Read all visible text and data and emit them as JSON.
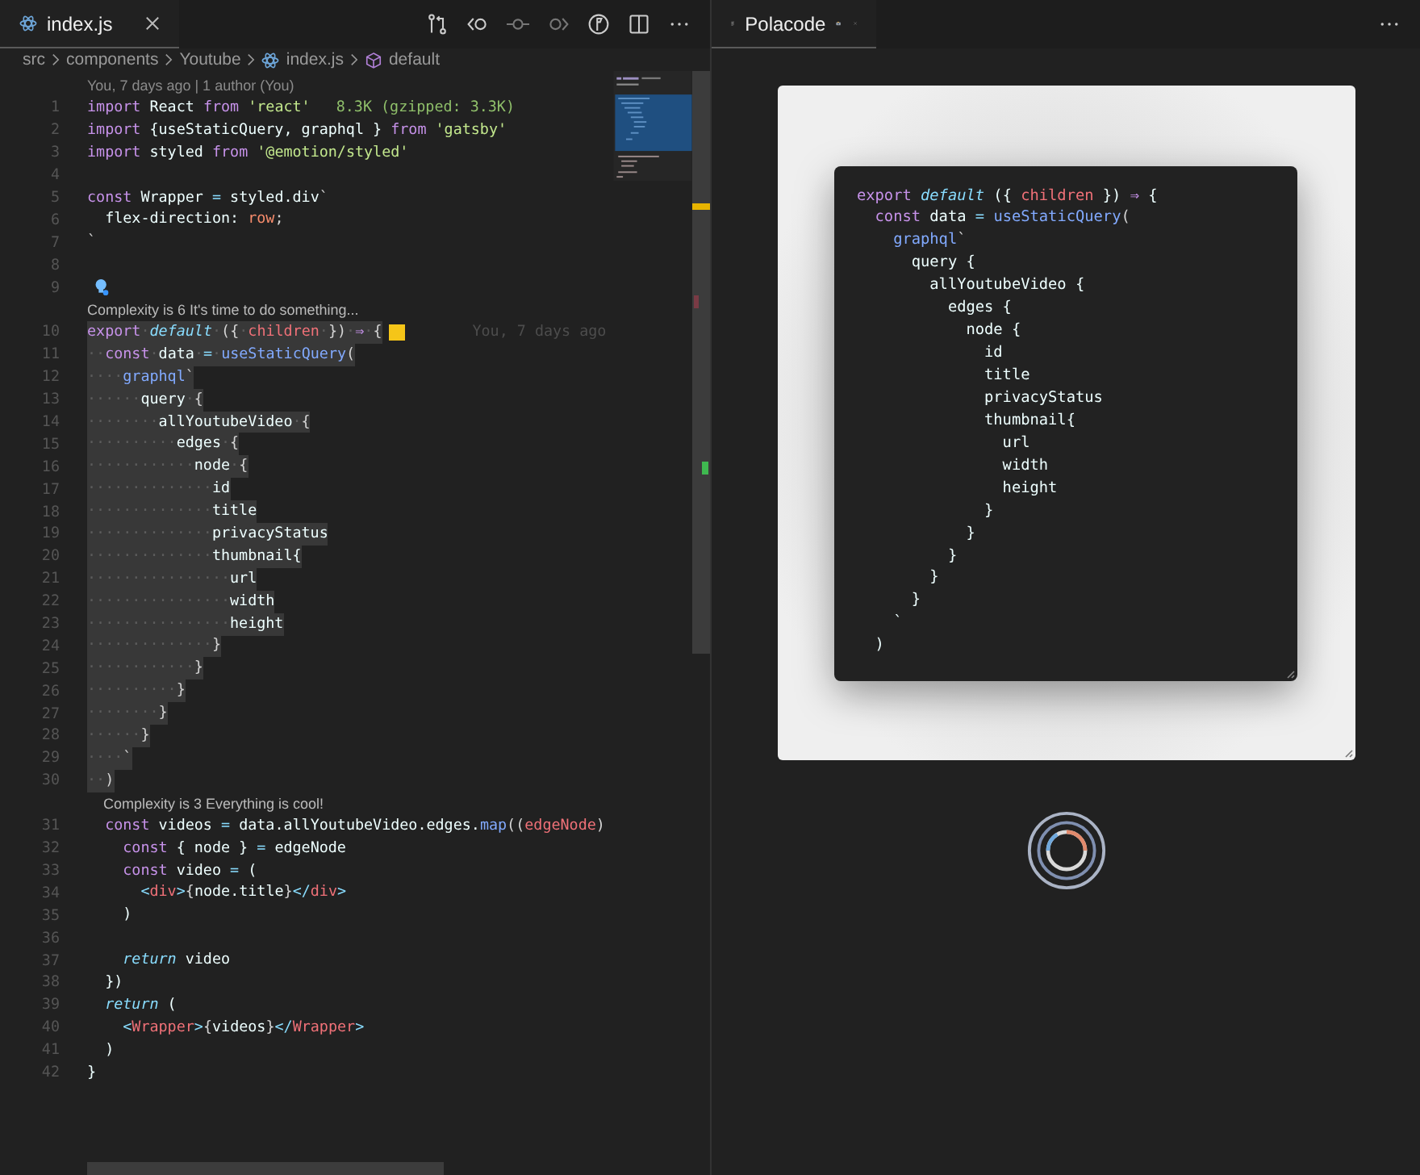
{
  "editor": {
    "tab": {
      "label": "index.js",
      "selected": true
    },
    "breadcrumbs": [
      "src",
      "components",
      "Youtube",
      "index.js",
      "default"
    ],
    "blame_header": "You, 7 days ago | 1 author (You)",
    "lines": [
      {
        "kind": "code",
        "number": "1",
        "selected": false,
        "annotation": "8.3K (gzipped: 3.3K)",
        "tokens": [
          {
            "kind": "keyword",
            "text": "import"
          },
          {
            "kind": "plain",
            "text": " React "
          },
          {
            "kind": "keyword",
            "text": "from"
          },
          {
            "kind": "string",
            "text": " 'react'"
          }
        ]
      },
      {
        "kind": "code",
        "number": "2",
        "selected": false,
        "tokens": [
          {
            "kind": "keyword",
            "text": "import"
          },
          {
            "kind": "plain",
            "text": " {useStaticQuery, graphql } "
          },
          {
            "kind": "keyword",
            "text": "from"
          },
          {
            "kind": "string",
            "text": " 'gatsby'"
          }
        ]
      },
      {
        "kind": "code",
        "number": "3",
        "selected": false,
        "tokens": [
          {
            "kind": "keyword",
            "text": "import"
          },
          {
            "kind": "plain",
            "text": " styled "
          },
          {
            "kind": "keyword",
            "text": "from"
          },
          {
            "kind": "string",
            "text": " '@emotion/styled'"
          }
        ]
      },
      {
        "kind": "code",
        "number": "4",
        "selected": false
      },
      {
        "kind": "code",
        "number": "5",
        "selected": false,
        "tokens": [
          {
            "kind": "keyword",
            "text": "const"
          },
          {
            "kind": "plain",
            "text": " Wrapper "
          },
          {
            "kind": "op",
            "text": "="
          },
          {
            "kind": "plain",
            "text": " styled.div"
          },
          {
            "kind": "punct",
            "text": "`"
          }
        ]
      },
      {
        "kind": "code",
        "number": "6",
        "selected": false,
        "tokens": [
          {
            "kind": "plain",
            "text": "  flex-direction: "
          },
          {
            "kind": "number",
            "text": "row"
          },
          {
            "kind": "punct",
            "text": ";"
          }
        ]
      },
      {
        "kind": "code",
        "number": "7",
        "selected": false,
        "tokens": [
          {
            "kind": "punct",
            "text": "`"
          }
        ]
      },
      {
        "kind": "code",
        "number": "8",
        "selected": false
      },
      {
        "kind": "code",
        "number": "9",
        "selected": false,
        "lightbulb": true
      },
      {
        "kind": "lens",
        "text": "Complexity is 6 It's time to do something..."
      },
      {
        "kind": "code",
        "number": "10",
        "selected": true,
        "blame": "You, 7 days ago",
        "tokens": [
          {
            "kind": "keyword",
            "text": "export"
          },
          {
            "kind": "ws",
            "text": "·"
          },
          {
            "kind": "italic",
            "text": "default"
          },
          {
            "kind": "ws",
            "text": "·"
          },
          {
            "kind": "punct",
            "text": "({"
          },
          {
            "kind": "ws",
            "text": "·"
          },
          {
            "kind": "param",
            "text": "children"
          },
          {
            "kind": "ws",
            "text": "·"
          },
          {
            "kind": "punct",
            "text": "})"
          },
          {
            "kind": "ws",
            "text": "·"
          },
          {
            "kind": "keyword",
            "text": "⇒"
          },
          {
            "kind": "ws",
            "text": "·"
          },
          {
            "kind": "punct",
            "text": "{"
          }
        ]
      },
      {
        "kind": "code",
        "number": "11",
        "selected": true,
        "tokens": [
          {
            "kind": "ws",
            "text": "··"
          },
          {
            "kind": "keyword",
            "text": "const"
          },
          {
            "kind": "ws",
            "text": "·"
          },
          {
            "kind": "plain",
            "text": "data"
          },
          {
            "kind": "ws",
            "text": "·"
          },
          {
            "kind": "op",
            "text": "="
          },
          {
            "kind": "ws",
            "text": "·"
          },
          {
            "kind": "fn",
            "text": "useStaticQuery"
          },
          {
            "kind": "punct",
            "text": "("
          }
        ]
      },
      {
        "kind": "code",
        "number": "12",
        "selected": true,
        "tokens": [
          {
            "kind": "ws",
            "text": "····"
          },
          {
            "kind": "fn",
            "text": "graphql"
          },
          {
            "kind": "punct",
            "text": "`"
          }
        ]
      },
      {
        "kind": "code",
        "number": "13",
        "selected": true,
        "tokens": [
          {
            "kind": "ws",
            "text": "······"
          },
          {
            "kind": "plain",
            "text": "query"
          },
          {
            "kind": "ws",
            "text": "·"
          },
          {
            "kind": "punct",
            "text": "{"
          }
        ]
      },
      {
        "kind": "code",
        "number": "14",
        "selected": true,
        "tokens": [
          {
            "kind": "ws",
            "text": "········"
          },
          {
            "kind": "plain",
            "text": "allYoutubeVideo"
          },
          {
            "kind": "ws",
            "text": "·"
          },
          {
            "kind": "punct",
            "text": "{"
          }
        ]
      },
      {
        "kind": "code",
        "number": "15",
        "selected": true,
        "tokens": [
          {
            "kind": "ws",
            "text": "··········"
          },
          {
            "kind": "plain",
            "text": "edges"
          },
          {
            "kind": "ws",
            "text": "·"
          },
          {
            "kind": "punct",
            "text": "{"
          }
        ]
      },
      {
        "kind": "code",
        "number": "16",
        "selected": true,
        "tokens": [
          {
            "kind": "ws",
            "text": "············"
          },
          {
            "kind": "plain",
            "text": "node"
          },
          {
            "kind": "ws",
            "text": "·"
          },
          {
            "kind": "punct",
            "text": "{"
          }
        ]
      },
      {
        "kind": "code",
        "number": "17",
        "selected": true,
        "tokens": [
          {
            "kind": "ws",
            "text": "··············"
          },
          {
            "kind": "plain",
            "text": "id"
          }
        ]
      },
      {
        "kind": "code",
        "number": "18",
        "selected": true,
        "tokens": [
          {
            "kind": "ws",
            "text": "··············"
          },
          {
            "kind": "plain",
            "text": "title"
          }
        ]
      },
      {
        "kind": "code",
        "number": "19",
        "selected": true,
        "tokens": [
          {
            "kind": "ws",
            "text": "··············"
          },
          {
            "kind": "plain",
            "text": "privacyStatus"
          }
        ]
      },
      {
        "kind": "code",
        "number": "20",
        "selected": true,
        "tokens": [
          {
            "kind": "ws",
            "text": "··············"
          },
          {
            "kind": "plain",
            "text": "thumbnail{"
          }
        ]
      },
      {
        "kind": "code",
        "number": "21",
        "selected": true,
        "tokens": [
          {
            "kind": "ws",
            "text": "················"
          },
          {
            "kind": "plain",
            "text": "url"
          }
        ]
      },
      {
        "kind": "code",
        "number": "22",
        "selected": true,
        "tokens": [
          {
            "kind": "ws",
            "text": "················"
          },
          {
            "kind": "plain",
            "text": "width"
          }
        ]
      },
      {
        "kind": "code",
        "number": "23",
        "selected": true,
        "tokens": [
          {
            "kind": "ws",
            "text": "················"
          },
          {
            "kind": "plain",
            "text": "height"
          }
        ]
      },
      {
        "kind": "code",
        "number": "24",
        "selected": true,
        "tokens": [
          {
            "kind": "ws",
            "text": "··············"
          },
          {
            "kind": "punct",
            "text": "}"
          }
        ]
      },
      {
        "kind": "code",
        "number": "25",
        "selected": true,
        "tokens": [
          {
            "kind": "ws",
            "text": "············"
          },
          {
            "kind": "punct",
            "text": "}"
          }
        ]
      },
      {
        "kind": "code",
        "number": "26",
        "selected": true,
        "tokens": [
          {
            "kind": "ws",
            "text": "··········"
          },
          {
            "kind": "punct",
            "text": "}"
          }
        ]
      },
      {
        "kind": "code",
        "number": "27",
        "selected": true,
        "tokens": [
          {
            "kind": "ws",
            "text": "········"
          },
          {
            "kind": "punct",
            "text": "}"
          }
        ]
      },
      {
        "kind": "code",
        "number": "28",
        "selected": true,
        "tokens": [
          {
            "kind": "ws",
            "text": "······"
          },
          {
            "kind": "punct",
            "text": "}"
          }
        ]
      },
      {
        "kind": "code",
        "number": "29",
        "selected": true,
        "tokens": [
          {
            "kind": "ws",
            "text": "····"
          },
          {
            "kind": "punct",
            "text": "`"
          }
        ]
      },
      {
        "kind": "code",
        "number": "30",
        "selected": true,
        "tokens": [
          {
            "kind": "ws",
            "text": "··"
          },
          {
            "kind": "punct",
            "text": ")"
          }
        ]
      },
      {
        "kind": "lens",
        "text": "Complexity is 3 Everything is cool!"
      },
      {
        "kind": "code",
        "number": "31",
        "selected": false,
        "tokens": [
          {
            "kind": "keyword",
            "text": "  const"
          },
          {
            "kind": "plain",
            "text": " videos "
          },
          {
            "kind": "op",
            "text": "="
          },
          {
            "kind": "plain",
            "text": " data.allYoutubeVideo.edges."
          },
          {
            "kind": "fn",
            "text": "map"
          },
          {
            "kind": "punct",
            "text": "(("
          },
          {
            "kind": "param",
            "text": "edgeNode"
          },
          {
            "kind": "punct",
            "text": ")"
          }
        ]
      },
      {
        "kind": "code",
        "number": "32",
        "selected": false,
        "tokens": [
          {
            "kind": "keyword",
            "text": "    const"
          },
          {
            "kind": "plain",
            "text": " { node } "
          },
          {
            "kind": "op",
            "text": "="
          },
          {
            "kind": "plain",
            "text": " edgeNode"
          }
        ]
      },
      {
        "kind": "code",
        "number": "33",
        "selected": false,
        "tokens": [
          {
            "kind": "keyword",
            "text": "    const"
          },
          {
            "kind": "plain",
            "text": " video "
          },
          {
            "kind": "op",
            "text": "="
          },
          {
            "kind": "plain",
            "text": " ("
          }
        ]
      },
      {
        "kind": "code",
        "number": "34",
        "selected": false,
        "tokens": [
          {
            "kind": "op",
            "text": "      <"
          },
          {
            "kind": "param",
            "text": "div"
          },
          {
            "kind": "op",
            "text": ">"
          },
          {
            "kind": "punct",
            "text": "{"
          },
          {
            "kind": "plain",
            "text": "node.title"
          },
          {
            "kind": "punct",
            "text": "}"
          },
          {
            "kind": "op",
            "text": "</"
          },
          {
            "kind": "param",
            "text": "div"
          },
          {
            "kind": "op",
            "text": ">"
          }
        ]
      },
      {
        "kind": "code",
        "number": "35",
        "selected": false,
        "tokens": [
          {
            "kind": "plain",
            "text": "    )"
          }
        ]
      },
      {
        "kind": "code",
        "number": "36",
        "selected": false
      },
      {
        "kind": "code",
        "number": "37",
        "selected": false,
        "tokens": [
          {
            "kind": "italic",
            "text": "    return"
          },
          {
            "kind": "plain",
            "text": " video"
          }
        ]
      },
      {
        "kind": "code",
        "number": "38",
        "selected": false,
        "tokens": [
          {
            "kind": "plain",
            "text": "  })"
          }
        ]
      },
      {
        "kind": "code",
        "number": "39",
        "selected": false,
        "tokens": [
          {
            "kind": "italic",
            "text": "  return"
          },
          {
            "kind": "plain",
            "text": " ("
          }
        ]
      },
      {
        "kind": "code",
        "number": "40",
        "selected": false,
        "tokens": [
          {
            "kind": "op",
            "text": "    <"
          },
          {
            "kind": "param",
            "text": "Wrapper"
          },
          {
            "kind": "op",
            "text": ">"
          },
          {
            "kind": "punct",
            "text": "{"
          },
          {
            "kind": "plain",
            "text": "videos"
          },
          {
            "kind": "punct",
            "text": "}"
          },
          {
            "kind": "op",
            "text": "</"
          },
          {
            "kind": "param",
            "text": "Wrapper"
          },
          {
            "kind": "op",
            "text": ">"
          }
        ]
      },
      {
        "kind": "code",
        "number": "41",
        "selected": false,
        "tokens": [
          {
            "kind": "plain",
            "text": "  )"
          }
        ]
      },
      {
        "kind": "code",
        "number": "42",
        "selected": false,
        "tokens": [
          {
            "kind": "plain",
            "text": "}"
          }
        ]
      }
    ]
  },
  "polacode": {
    "tab": {
      "label": "Polacode",
      "selected": true
    },
    "snippet": [
      {
        "tokens": [
          {
            "kind": "keyword",
            "text": "export"
          },
          {
            "kind": "italic",
            "text": " default"
          },
          {
            "kind": "plain",
            "text": " ({ "
          },
          {
            "kind": "param",
            "text": "children"
          },
          {
            "kind": "plain",
            "text": " }) "
          },
          {
            "kind": "keyword",
            "text": "⇒"
          },
          {
            "kind": "plain",
            "text": " {"
          }
        ]
      },
      {
        "tokens": [
          {
            "kind": "keyword",
            "text": "  const"
          },
          {
            "kind": "plain",
            "text": " data "
          },
          {
            "kind": "op",
            "text": "="
          },
          {
            "kind": "fn",
            "text": " useStaticQuery"
          },
          {
            "kind": "punct",
            "text": "("
          }
        ]
      },
      {
        "tokens": [
          {
            "kind": "fn",
            "text": "    graphql"
          },
          {
            "kind": "punct",
            "text": "`"
          }
        ]
      },
      {
        "tokens": [
          {
            "kind": "plain",
            "text": "      query {"
          }
        ]
      },
      {
        "tokens": [
          {
            "kind": "plain",
            "text": "        allYoutubeVideo {"
          }
        ]
      },
      {
        "tokens": [
          {
            "kind": "plain",
            "text": "          edges {"
          }
        ]
      },
      {
        "tokens": [
          {
            "kind": "plain",
            "text": "            node {"
          }
        ]
      },
      {
        "tokens": [
          {
            "kind": "plain",
            "text": "              id"
          }
        ]
      },
      {
        "tokens": [
          {
            "kind": "plain",
            "text": "              title"
          }
        ]
      },
      {
        "tokens": [
          {
            "kind": "plain",
            "text": "              privacyStatus"
          }
        ]
      },
      {
        "tokens": [
          {
            "kind": "plain",
            "text": "              thumbnail{"
          }
        ]
      },
      {
        "tokens": [
          {
            "kind": "plain",
            "text": "                url"
          }
        ]
      },
      {
        "tokens": [
          {
            "kind": "plain",
            "text": "                width"
          }
        ]
      },
      {
        "tokens": [
          {
            "kind": "plain",
            "text": "                height"
          }
        ]
      },
      {
        "tokens": [
          {
            "kind": "plain",
            "text": "              }"
          }
        ]
      },
      {
        "tokens": [
          {
            "kind": "plain",
            "text": "            }"
          }
        ]
      },
      {
        "tokens": [
          {
            "kind": "plain",
            "text": "          }"
          }
        ]
      },
      {
        "tokens": [
          {
            "kind": "plain",
            "text": "        }"
          }
        ]
      },
      {
        "tokens": [
          {
            "kind": "plain",
            "text": "      }"
          }
        ]
      },
      {
        "tokens": [
          {
            "kind": "plain",
            "text": "    `"
          }
        ]
      },
      {
        "tokens": [
          {
            "kind": "plain",
            "text": "  )"
          }
        ]
      }
    ]
  }
}
